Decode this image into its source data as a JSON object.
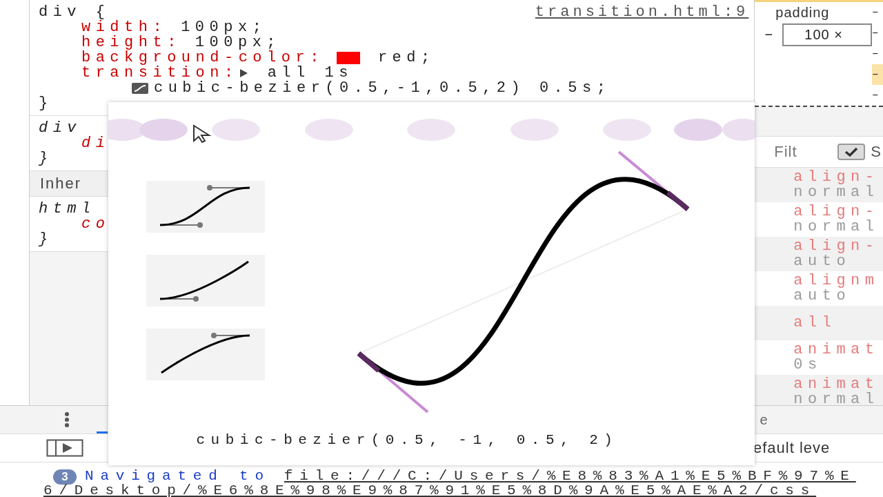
{
  "styles": {
    "rules": [
      {
        "kind": "rule",
        "selector": "div {",
        "italic": false,
        "source": "transition.html:9",
        "declarations": [
          {
            "kind": "plain",
            "name": "width:",
            "value": "100px;"
          },
          {
            "kind": "plain",
            "name": "height:",
            "value": "100px;"
          },
          {
            "kind": "color",
            "name": "background-color:",
            "color": "#ff0000",
            "value": "red;"
          },
          {
            "kind": "shorthand",
            "name": "transition:",
            "expanded": false,
            "value": "all 1s"
          },
          {
            "kind": "easing",
            "value": "cubic-bezier(0.5,-1,0.5,2) 0.5s;"
          }
        ],
        "close": "}"
      },
      {
        "kind": "rule",
        "selector": "div",
        "italic": true,
        "declarations": [
          {
            "kind": "plain",
            "name": "di"
          }
        ],
        "close": "}"
      },
      {
        "kind": "section",
        "label": "Inher"
      },
      {
        "kind": "rule",
        "selector": "html",
        "italic": true,
        "declarations": [
          {
            "kind": "plain",
            "name": "co"
          }
        ],
        "close": "}"
      }
    ]
  },
  "box_model": {
    "label": "padding",
    "content": "100 ×",
    "left_dash": "–",
    "right_dashes": [
      {
        "text": "–",
        "highlighted": false
      },
      {
        "text": "–",
        "highlighted": false
      },
      {
        "text": "–",
        "highlighted": false
      },
      {
        "text": "–",
        "highlighted": true
      },
      {
        "text": "–",
        "highlighted": false
      }
    ]
  },
  "computed": {
    "filter": {
      "placeholder": "Filt"
    },
    "show_all": {
      "checked": true,
      "label": "S"
    },
    "rows": [
      {
        "name": "align-",
        "value": "normal"
      },
      {
        "name": "align-",
        "value": "normal"
      },
      {
        "name": "align-",
        "value": "auto"
      },
      {
        "name": "alignm",
        "value": "auto"
      },
      {
        "name": "all"
      },
      {
        "name": "animat",
        "value": "0s"
      },
      {
        "name": "animat",
        "value": "normal"
      }
    ]
  },
  "popover": {
    "presets": [
      {
        "kind": "ease-in-out"
      },
      {
        "kind": "ease-in"
      },
      {
        "kind": "ease-out"
      }
    ],
    "label": "cubic-bezier(0.5, -1, 0.5, 2)"
  },
  "console": {
    "tab_fragment": "e",
    "level_fragment": "efault leve",
    "message": {
      "count": "3",
      "text": "Navigated to",
      "link": [
        "file:///C:/Users/%E8%83%A1%E5%BF%97%E",
        "6/Desktop/%E6%8E%98%E9%87%91%E5%8D%9A%E5%AE%A2/css"
      ]
    }
  }
}
